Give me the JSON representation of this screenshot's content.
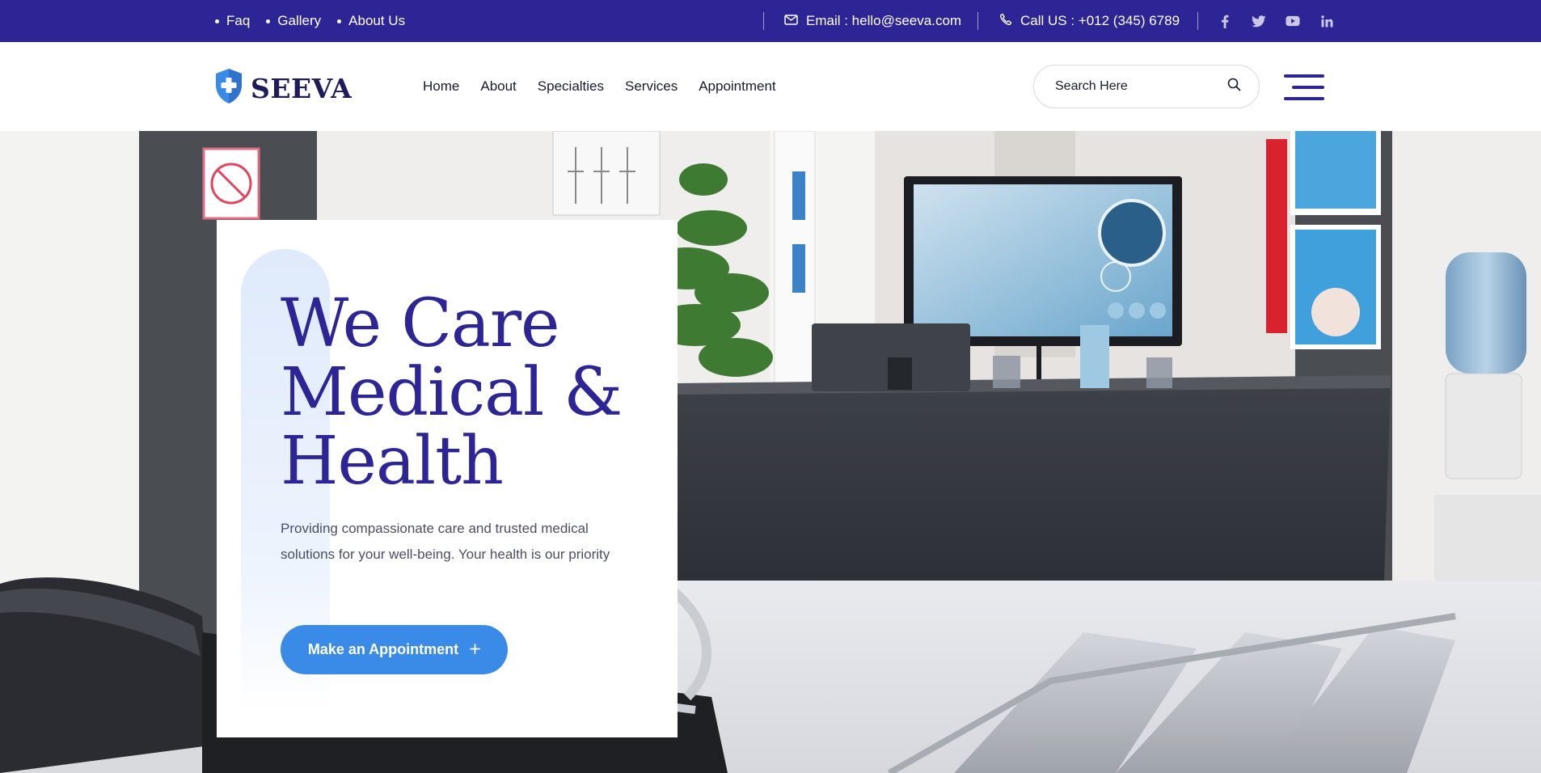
{
  "topbar": {
    "links": [
      "Faq",
      "Gallery",
      "About Us"
    ],
    "email_text": "Email : hello@seeva.com",
    "phone_text": "Call US : +012 (345) 6789",
    "social_icons": [
      "facebook-icon",
      "twitter-icon",
      "youtube-icon",
      "linkedin-icon"
    ],
    "bg_color": "#2d2495"
  },
  "header": {
    "logo_text": "SEEVA",
    "nav": [
      "Home",
      "About",
      "Specialties",
      "Services",
      "Appointment"
    ],
    "search_placeholder": "Search Here"
  },
  "hero": {
    "title_line1": "We Care",
    "title_line2": "Medical &",
    "title_line3": "Health",
    "description": "Providing compassionate care and trusted medical solutions for your well-being. Your health is our priority",
    "cta_label": "Make an Appointment",
    "accent_color": "#3a8ae8",
    "title_color": "#2d2495"
  }
}
